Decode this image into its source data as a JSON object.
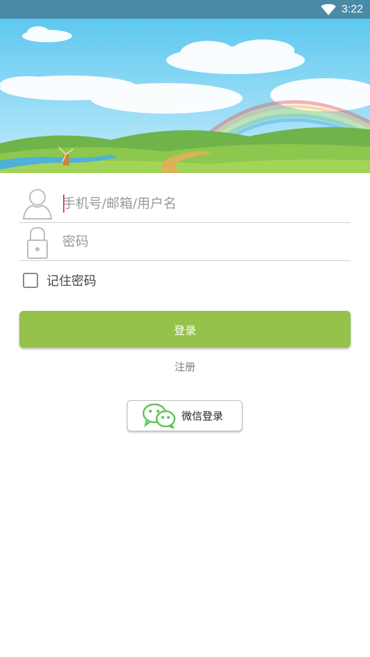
{
  "status_bar": {
    "time": "3:22",
    "wifi_icon": "wifi-icon"
  },
  "banner": {
    "scene": "cartoon-landscape-with-rainbow-and-windmill"
  },
  "form": {
    "username_placeholder": "手机号/邮箱/用户名",
    "username_value": "",
    "username_icon": "user-icon",
    "password_placeholder": "密码",
    "password_value": "",
    "password_icon": "lock-icon",
    "remember_label": "记住密码",
    "remember_checked": false
  },
  "actions": {
    "login_label": "登录",
    "register_label": "注册",
    "wechat_login_label": "微信登录",
    "wechat_icon": "wechat-icon"
  },
  "colors": {
    "status_bar": "#4a8aa6",
    "primary_button": "#94c24a",
    "wechat_green": "#5fc45a",
    "cursor": "#e0457b"
  }
}
